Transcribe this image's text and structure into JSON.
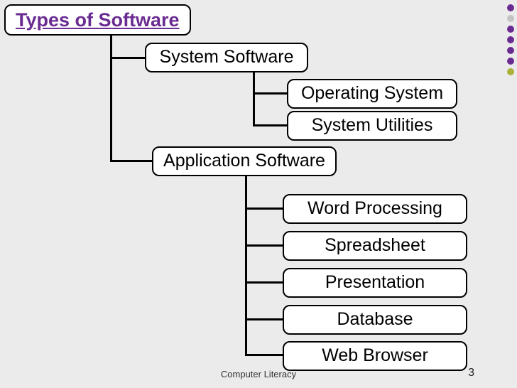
{
  "title": "Types of Software",
  "nodes": {
    "system": "System Software",
    "application": "Application Software",
    "os": "Operating System",
    "utils": "System Utilities",
    "word": "Word Processing",
    "spread": "Spreadsheet",
    "pres": "Presentation",
    "db": "Database",
    "browser": "Web Browser"
  },
  "footer": {
    "course": "Computer Literacy",
    "page": "3"
  },
  "decoration": {
    "dot_colors_row": [
      "#6b2c91",
      "#6b2c91",
      "#6b2c91",
      "#6b2c91",
      "#7c9a3f",
      "#c4c4c4",
      "#6b2c91",
      "#6b2c91",
      "#6b2c91",
      "#4b8a8c",
      "#6b2c91",
      "#6b2c91",
      "#6b2c91",
      "#6b2c91",
      "#c4c4c4",
      "#6b2c91",
      "#abb03a",
      "#6b2c91",
      "#6b2c91",
      "#6b2c91",
      "#6b2c91",
      "#6b2c91",
      "#4b8a8c",
      "#6b2c91",
      "#6b2c91",
      "#6b2c91",
      "#6b2c91",
      "#6b2c91",
      "#6b2c91",
      "#6b2c91",
      "#abb03a",
      "#c4c4c4",
      "#6b2c91",
      "#c4c4c4",
      "#6b2c91"
    ]
  }
}
